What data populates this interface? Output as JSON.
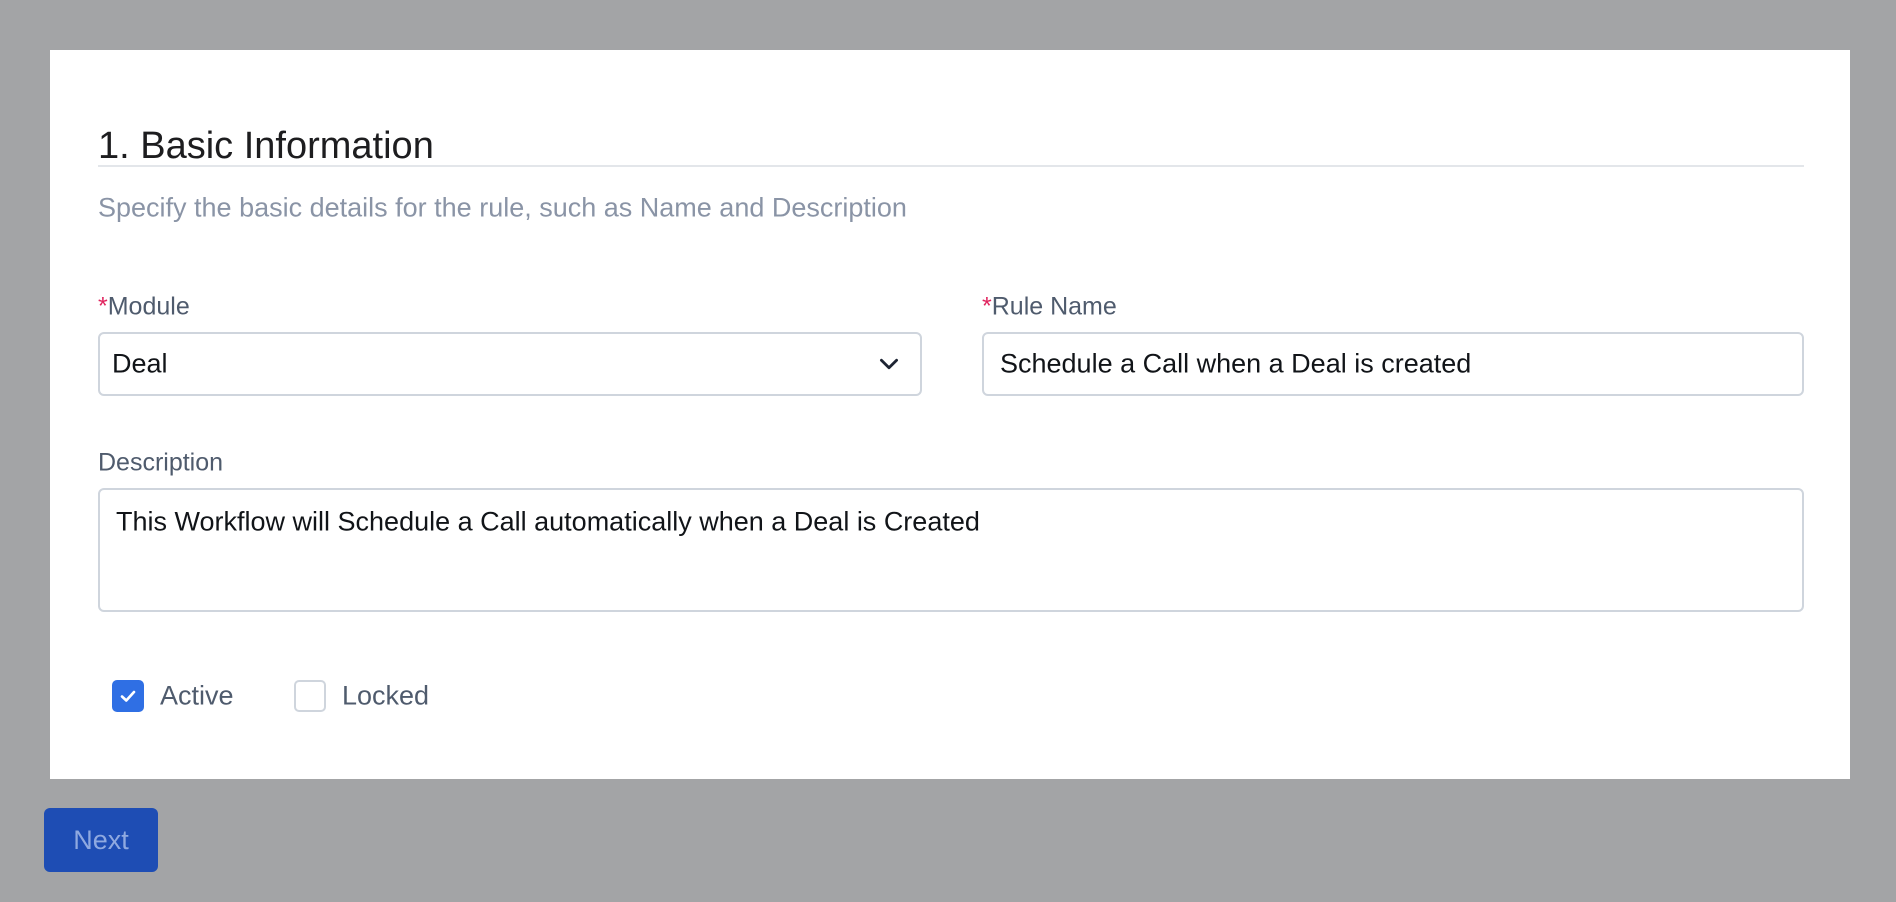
{
  "section": {
    "title": "1. Basic Information",
    "subtitle": "Specify the basic details for the rule, such as Name and Description"
  },
  "form": {
    "required_marker": "*",
    "module": {
      "label": "Module",
      "value": "Deal"
    },
    "rule_name": {
      "label": "Rule Name",
      "value": "Schedule a Call when a Deal is created"
    },
    "description": {
      "label": "Description",
      "value": "This Workflow will Schedule a Call automatically when a Deal is Created"
    },
    "active": {
      "label": "Active",
      "checked": true
    },
    "locked": {
      "label": "Locked",
      "checked": false
    }
  },
  "footer": {
    "next_label": "Next"
  },
  "colors": {
    "accent": "#2f6fe4",
    "button_bg": "#1e4db4",
    "required": "#e0245e",
    "overlay": "#a3a4a6"
  },
  "icons": {
    "module_dropdown": "chevron-down-icon",
    "active_checkbox": "check-icon"
  }
}
